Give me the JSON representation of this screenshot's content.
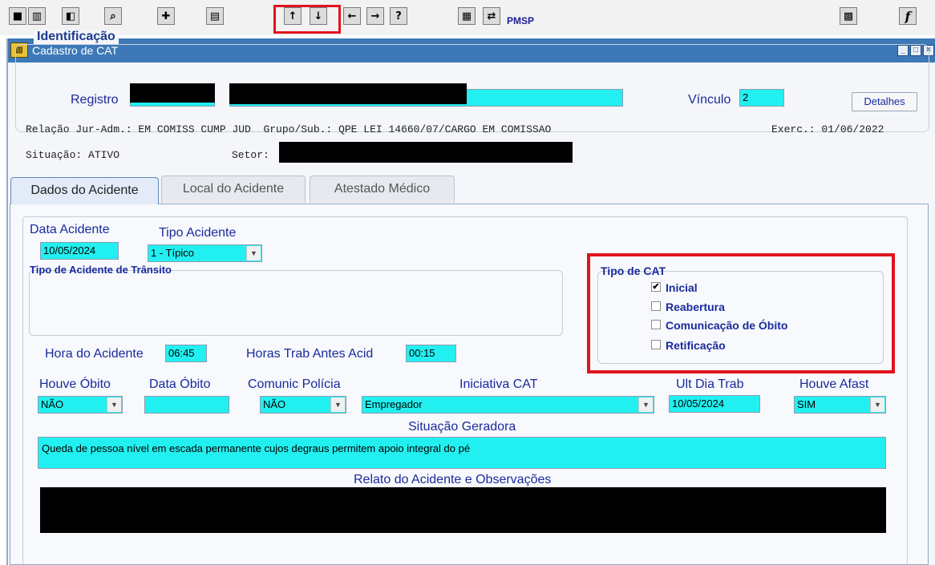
{
  "toolbar": {
    "buttons": [
      {
        "icon": "save-icon",
        "glyph": "■"
      },
      {
        "icon": "trash-icon",
        "glyph": "▥"
      },
      {
        "icon": "exit-icon",
        "glyph": "◧"
      },
      {
        "icon": "search-icon",
        "glyph": "⌕"
      },
      {
        "icon": "new-record-icon",
        "glyph": "✚"
      },
      {
        "icon": "clear-icon",
        "glyph": "▤"
      },
      {
        "icon": "previous-record-icon",
        "glyph": "↑"
      },
      {
        "icon": "next-record-icon",
        "glyph": "↓"
      },
      {
        "icon": "arrow-left-icon",
        "glyph": "←"
      },
      {
        "icon": "arrow-right-icon",
        "glyph": "→"
      },
      {
        "icon": "help-icon",
        "glyph": "?"
      },
      {
        "icon": "calculator-icon",
        "glyph": "▦"
      },
      {
        "icon": "emp-icon",
        "glyph": "⇄"
      }
    ],
    "pmsp_label": "PMSP",
    "right_icons": [
      {
        "icon": "keyboard-icon",
        "glyph": "▩"
      },
      {
        "icon": "function-icon",
        "glyph": "f"
      }
    ],
    "highlight_color": "#e0141e"
  },
  "window": {
    "title": "Cadastro de CAT",
    "controls": [
      "_",
      "□",
      "×"
    ]
  },
  "identificacao": {
    "legend": "Identificação",
    "registro_label": "Registro",
    "vinculo_label": "Vínculo",
    "vinculo_value": "2",
    "detalhes_button": "Detalhes",
    "line1": "Relação Jur-Adm.: EM COMISS CUMP JUD  Grupo/Sub.: QPE LEI 14660/07/CARGO EM COMISSAO",
    "exercicio": "Exerc.: 01/06/2022",
    "situacao": "Situação: ATIVO",
    "setor_label": "Setor:"
  },
  "tabs": [
    {
      "label": "Dados do Acidente",
      "active": true
    },
    {
      "label": "Local do Acidente",
      "active": false
    },
    {
      "label": "Atestado Médico",
      "active": false
    }
  ],
  "dados": {
    "data_acidente_label": "Data Acidente",
    "data_acidente_value": "10/05/2024",
    "tipo_acidente_label": "Tipo Acidente",
    "tipo_acidente_value": "1 - Típico",
    "tipo_transito_label": "Tipo de Acidente de Trânsito",
    "hora_label": "Hora do Acidente",
    "hora_value": "06:45",
    "horas_trab_label": "Horas Trab Antes Acid",
    "horas_trab_value": "00:15",
    "houve_obito_label": "Houve Óbito",
    "houve_obito_value": "NÃO",
    "data_obito_label": "Data Óbito",
    "data_obito_value": "",
    "comunic_policia_label": "Comunic Polícia",
    "comunic_policia_value": "NÃO",
    "iniciativa_label": "Iniciativa CAT",
    "iniciativa_value": "Empregador",
    "ult_dia_label": "Ult Dia Trab",
    "ult_dia_value": "10/05/2024",
    "houve_afast_label": "Houve Afast",
    "houve_afast_value": "SIM",
    "situacao_geradora_label": "Situação Geradora",
    "situacao_geradora_value": "Queda de pessoa nível em escada permanente cujos degraus permitem apoio integral do pé",
    "relato_label": "Relato do Acidente e Observações"
  },
  "tipo_cat": {
    "label": "Tipo de CAT",
    "options": [
      {
        "label": "Inicial",
        "checked": true
      },
      {
        "label": "Reabertura",
        "checked": false
      },
      {
        "label": "Comunicação de Óbito",
        "checked": false
      },
      {
        "label": "Retificação",
        "checked": false
      }
    ]
  },
  "colors": {
    "field_bg": "#22f0f0",
    "label_color": "#1a2a9c",
    "titlebar": "#3d79b7"
  }
}
